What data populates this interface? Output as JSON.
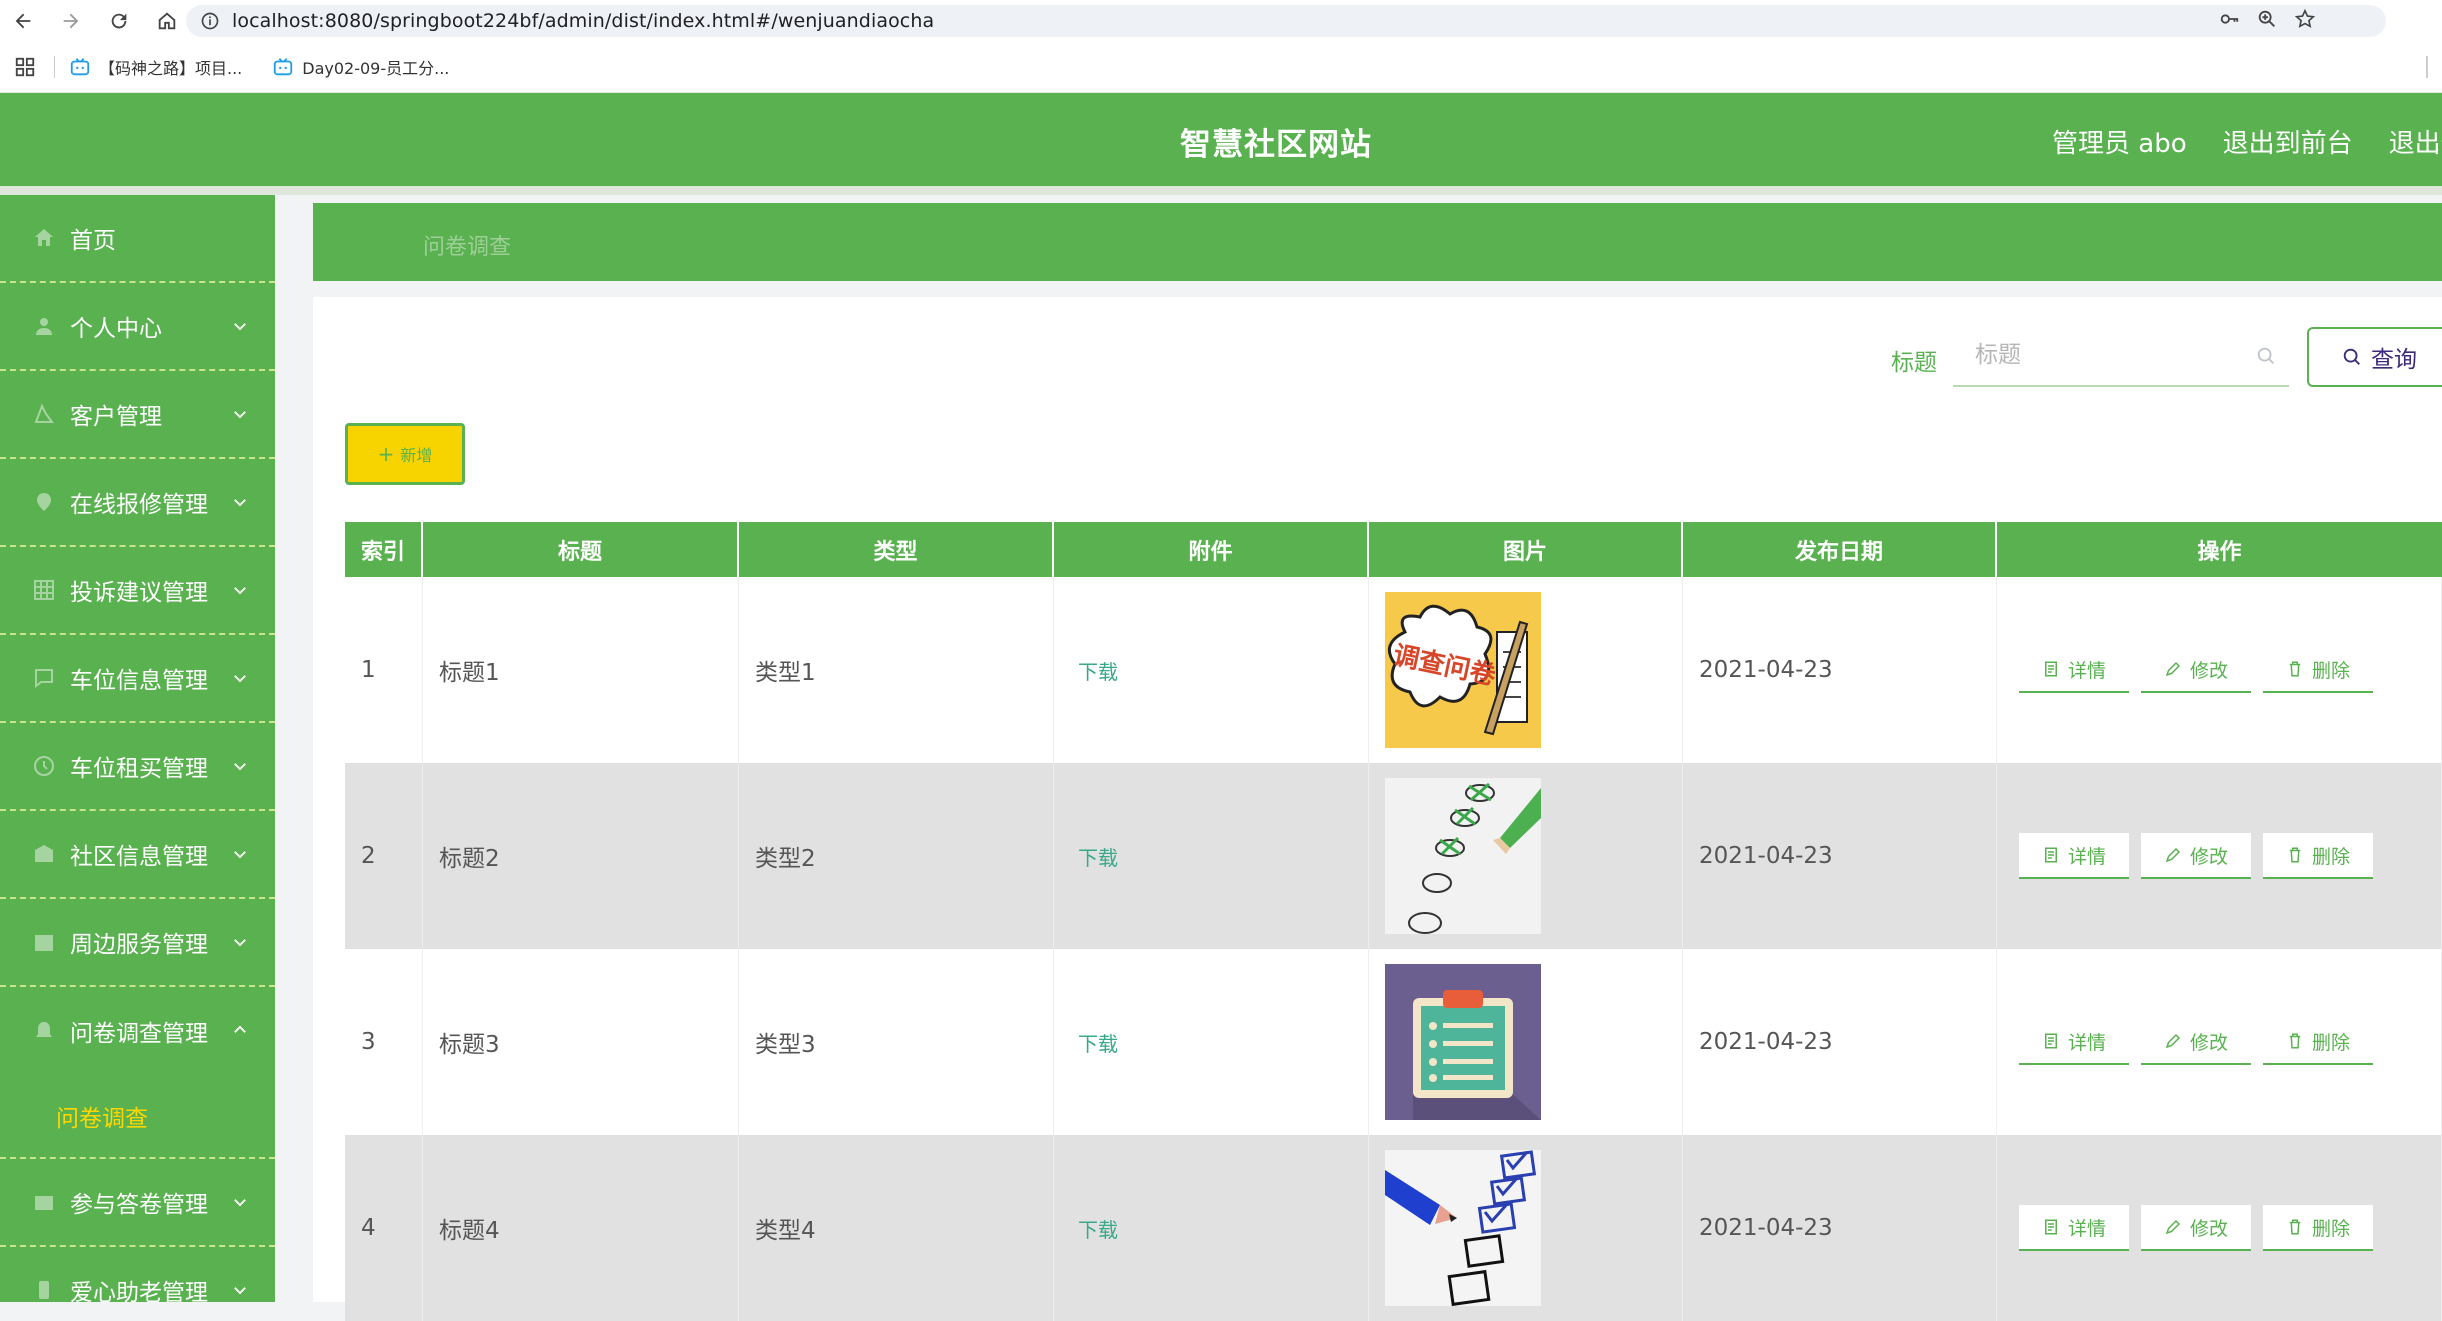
{
  "browser": {
    "url": "localhost:8080/springboot224bf/admin/dist/index.html#/wenjuandiaocha",
    "bookmarks": [
      {
        "label": "【码神之路】项目..."
      },
      {
        "label": "Day02-09-员工分..."
      }
    ]
  },
  "header": {
    "title": "智慧社区网站",
    "admin_label": "管理员 abo",
    "exit_front": "退出到前台",
    "exit_system": "退出登录"
  },
  "sidebar": {
    "items": [
      {
        "label": "首页",
        "icon": "home-icon",
        "expandable": false
      },
      {
        "label": "个人中心",
        "icon": "user-icon",
        "expandable": true
      },
      {
        "label": "客户管理",
        "icon": "customer-icon",
        "expandable": true
      },
      {
        "label": "在线报修管理",
        "icon": "repair-icon",
        "expandable": true
      },
      {
        "label": "投诉建议管理",
        "icon": "grid-icon",
        "expandable": true
      },
      {
        "label": "车位信息管理",
        "icon": "chat-icon",
        "expandable": true
      },
      {
        "label": "车位租买管理",
        "icon": "clock-icon",
        "expandable": true
      },
      {
        "label": "社区信息管理",
        "icon": "building-icon",
        "expandable": true
      },
      {
        "label": "周边服务管理",
        "icon": "calendar-icon",
        "expandable": true
      },
      {
        "label": "问卷调查管理",
        "icon": "bell-icon",
        "expandable": true,
        "expanded": true
      },
      {
        "label": "参与答卷管理",
        "icon": "box-icon",
        "expandable": true
      },
      {
        "label": "爱心助老管理",
        "icon": "phone-icon",
        "expandable": true
      }
    ],
    "active_sub": "问卷调查"
  },
  "breadcrumb": "问卷调查",
  "search": {
    "label": "标题",
    "placeholder": "标题",
    "value": "",
    "button": "查询"
  },
  "add_button": "新增",
  "table": {
    "headers": [
      "索引",
      "标题",
      "类型",
      "附件",
      "图片",
      "发布日期",
      "操作"
    ],
    "rows": [
      {
        "index": "1",
        "title": "标题1",
        "type": "类型1",
        "attachment": "下载",
        "image": "survey-cartoon-image",
        "date": "2021-04-23"
      },
      {
        "index": "2",
        "title": "标题2",
        "type": "类型2",
        "attachment": "下载",
        "image": "checkmarks-pencil-image",
        "date": "2021-04-23"
      },
      {
        "index": "3",
        "title": "标题3",
        "type": "类型3",
        "attachment": "下载",
        "image": "clipboard-image",
        "date": "2021-04-23"
      },
      {
        "index": "4",
        "title": "标题4",
        "type": "类型4",
        "attachment": "下载",
        "image": "checkbox-pen-image",
        "date": "2021-04-23"
      }
    ],
    "actions": {
      "detail": "详情",
      "edit": "修改",
      "delete": "删除"
    }
  },
  "colors": {
    "primary_green": "#59b150",
    "add_yellow": "#f7d400",
    "submenu_yellow": "#ffd700",
    "link_teal": "#3aa88a"
  }
}
